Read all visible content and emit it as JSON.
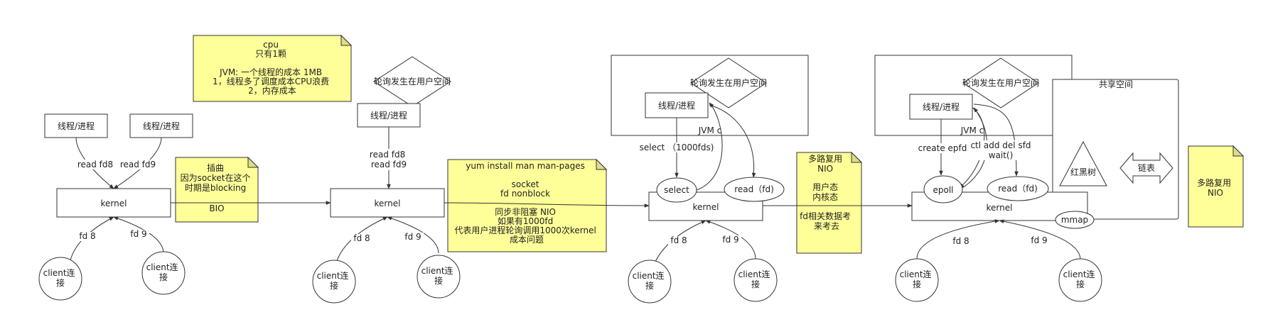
{
  "stage1": {
    "cpu_note": [
      "cpu",
      "只有1颗",
      "",
      "JVM: 一个线程的成本  1MB",
      "1，线程多了调度成本CPU浪费",
      "2，内存成本"
    ],
    "thread_a": "线程/进程",
    "thread_b": "线程/进程",
    "read_a": "read fd8",
    "read_b": "read fd9",
    "kernel": "kernel",
    "fd_a": "fd 8",
    "fd_b": "fd 9",
    "client_a": [
      "client连",
      "接"
    ],
    "client_b": [
      "client连",
      "接"
    ],
    "note": [
      "插曲",
      "因为socket在这个",
      "时期是blocking",
      "",
      "BIO"
    ]
  },
  "stage2": {
    "poll_diamond": "轮询发生在用户空间",
    "thread": "线程/进程",
    "reads": [
      "read fd8",
      "read fd9"
    ],
    "kernel": "kernel",
    "fd_a": "fd 8",
    "fd_b": "fd 9",
    "client_a": [
      "client连",
      "接"
    ],
    "client_b": [
      "client连",
      "接"
    ],
    "note": [
      "yum install man  man-pages",
      "",
      "socket",
      "fd nonblock",
      "",
      "同步非阻塞   NIO",
      "如果有1000fd",
      "代表用户进程轮询调用1000次kernel",
      "成本问题"
    ]
  },
  "stage3": {
    "poll_diamond": "轮询发生在用户空间",
    "thread": "线程/进程",
    "jvm_label": "JVM  c",
    "select_label": "select  （1000fds)",
    "select": "select",
    "read": "read（fd)",
    "kernel": "kernel",
    "fd_a": "fd 8",
    "fd_b": "fd 9",
    "client_a": [
      "client连",
      "接"
    ],
    "client_b": [
      "client连",
      "接"
    ],
    "note": [
      "多路复用",
      "NIO",
      "",
      "用户态",
      "内核态",
      "",
      "fd相关数据考",
      "来考去"
    ]
  },
  "stage4": {
    "poll_diamond": "轮询发生在用户空间",
    "thread": "线程/进程",
    "jvm_label": "JVM  c",
    "create_label": "create epfd",
    "ctl_label": "ctl add del sfd",
    "wait_label": "wait()",
    "epoll": "epoll",
    "read": "read（fd)",
    "kernel": "kernel",
    "shared_title": "共享空间",
    "rbtree": "红黑树",
    "linked_list": "链表",
    "mmap": "mmap",
    "fd_a": "fd 8",
    "fd_b": "fd 9",
    "client_a": [
      "client连",
      "接"
    ],
    "client_b": [
      "client连",
      "接"
    ],
    "note": [
      "多路复用",
      "NIO"
    ]
  },
  "colors": {
    "note_fill": "#ffff99",
    "stroke": "#333333",
    "background": "#ffffff"
  }
}
